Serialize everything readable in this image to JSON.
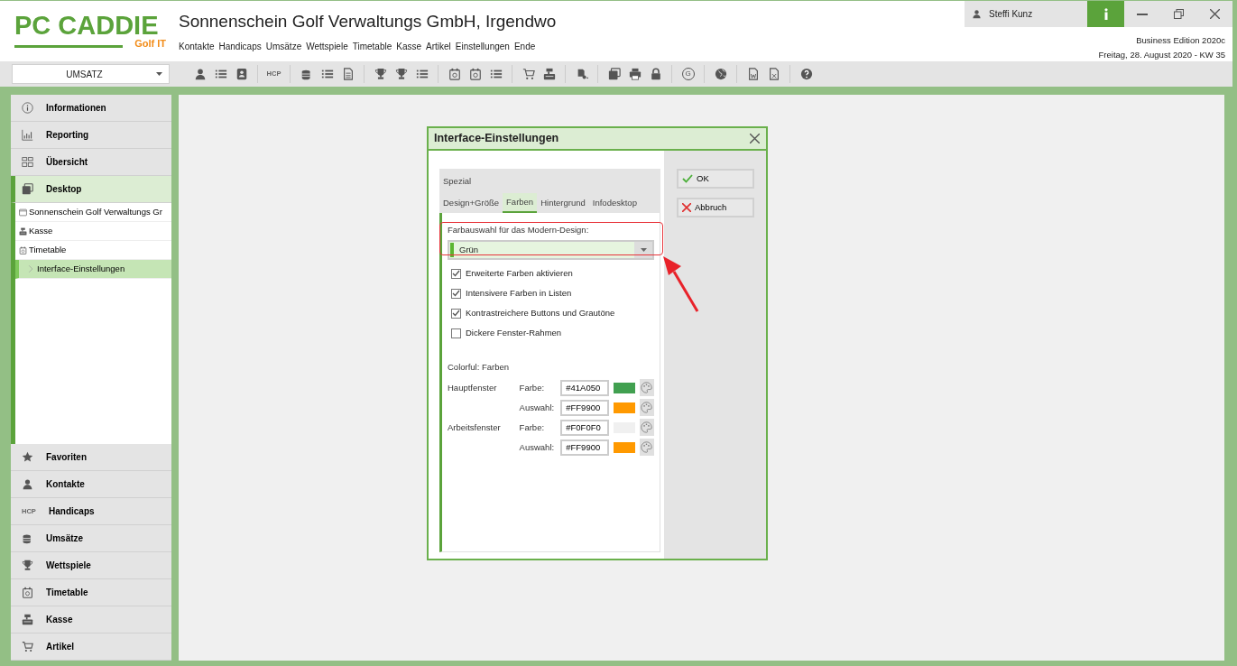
{
  "header": {
    "logo": "PC CADDIE",
    "logo_sub": "Golf IT",
    "title": "Sonnenschein Golf Verwaltungs GmbH, Irgendwo",
    "menu": [
      "Kontakte",
      "Handicaps",
      "Umsätze",
      "Wettspiele",
      "Timetable",
      "Kasse",
      "Artikel",
      "Einstellungen",
      "Ende"
    ],
    "user": "Steffi Kunz",
    "edition": "Business Edition 2020c",
    "date": "Freitag, 28. August 2020 - KW 35"
  },
  "toolbar": {
    "dropdown": "UMSATZ",
    "hcp_label": "HCP",
    "g_label": "G"
  },
  "sidebar": {
    "top_items": [
      {
        "label": "Informationen",
        "selected": false
      },
      {
        "label": "Reporting",
        "selected": false
      },
      {
        "label": "Übersicht",
        "selected": false
      },
      {
        "label": "Desktop",
        "selected": true,
        "expanded": true,
        "children": [
          {
            "label": "Sonnenschein Golf Verwaltungs Gr",
            "selected": false
          },
          {
            "label": "Kasse",
            "selected": false
          },
          {
            "label": "Timetable",
            "selected": false
          },
          {
            "label": "Interface-Einstellungen",
            "selected": true
          }
        ]
      }
    ],
    "bottom_items": [
      {
        "label": "Favoriten"
      },
      {
        "label": "Kontakte"
      },
      {
        "label": "Handicaps",
        "icon_text": "HCP"
      },
      {
        "label": "Umsätze"
      },
      {
        "label": "Wettspiele"
      },
      {
        "label": "Timetable"
      },
      {
        "label": "Kasse"
      },
      {
        "label": "Artikel"
      }
    ]
  },
  "dialog": {
    "title": "Interface-Einstellungen",
    "tab_rows": [
      [
        {
          "label": "Spezial",
          "selected": false
        }
      ],
      [
        {
          "label": "Design+Größe",
          "selected": false
        },
        {
          "label": "Farben",
          "selected": true
        },
        {
          "label": "Hintergrund",
          "selected": false
        },
        {
          "label": "Infodesktop",
          "selected": false
        }
      ]
    ],
    "design_label": "Farbauswahl für das Modern-Design:",
    "design_value": "Grün",
    "checkboxes": [
      {
        "label": "Erweiterte Farben aktivieren",
        "checked": true
      },
      {
        "label": "Intensivere Farben in Listen",
        "checked": true
      },
      {
        "label": "Kontrastreichere Buttons und Grautöne",
        "checked": true
      },
      {
        "label": "Dickere Fenster-Rahmen",
        "checked": false
      }
    ],
    "colors_title": "Colorful: Farben",
    "color_rows": [
      {
        "group": "Hauptfenster",
        "label": "Farbe:",
        "value": "#41A050",
        "color": "#41a050"
      },
      {
        "label": "Auswahl:",
        "value": "#FF9900",
        "color": "#ff9900"
      },
      {
        "group": "Arbeitsfenster",
        "label": "Farbe:",
        "value": "#F0F0F0",
        "color": "#f0f0f0"
      },
      {
        "label": "Auswahl:",
        "value": "#FF9900",
        "color": "#ff9900"
      }
    ],
    "buttons": [
      {
        "kind": "ok",
        "label": "OK"
      },
      {
        "kind": "cancel",
        "label": "Abbruch"
      }
    ]
  }
}
